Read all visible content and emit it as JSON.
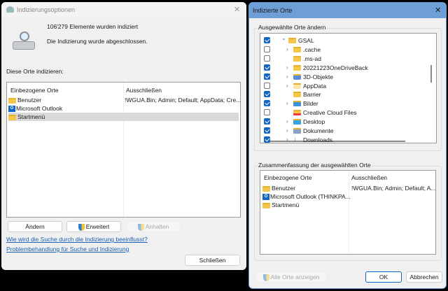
{
  "left": {
    "title": "Indizierungsoptionen",
    "count_text": "106'279 Elemente wurden indiziert",
    "status_text": "Die Indizierung wurde abgeschlossen.",
    "section_label": "Diese Orte indizieren:",
    "columns": [
      "Einbezogene Orte",
      "Ausschließen"
    ],
    "rows": [
      {
        "name": "Benutzer",
        "exclude": "!WGUA.Bin; Admin; Default; AppData; Cre..."
      },
      {
        "name": "Microsoft Outlook",
        "exclude": ""
      },
      {
        "name": "Startmenü",
        "exclude": ""
      }
    ],
    "buttons": {
      "change": "Ändern",
      "advanced": "Erweitert",
      "pause": "Anhalten",
      "close": "Schließen"
    },
    "links": [
      "Wie wird die Suche durch die Indizierung beeinflusst?",
      "Problembehandlung für Suche und Indizierung"
    ]
  },
  "right": {
    "title": "Indizierte Orte",
    "group1": "Ausgewählte Orte ändern",
    "tree": [
      {
        "name": "GSAL",
        "checked": true
      },
      {
        "name": ".cache",
        "checked": false
      },
      {
        "name": ".ms-ad",
        "checked": false
      },
      {
        "name": "20221223OneDriveBack",
        "checked": true
      },
      {
        "name": "3D-Objekte",
        "checked": true
      },
      {
        "name": "AppData",
        "checked": false
      },
      {
        "name": "Barrier",
        "checked": true
      },
      {
        "name": "Bilder",
        "checked": true
      },
      {
        "name": "Creative Cloud Files",
        "checked": false
      },
      {
        "name": "Desktop",
        "checked": true
      },
      {
        "name": "Dokumente",
        "checked": true
      },
      {
        "name": "Downloads",
        "checked": true
      }
    ],
    "group2": "Zusammenfassung der ausgewählten Orte",
    "columns": [
      "Einbezogene Orte",
      "Ausschließen"
    ],
    "rows": [
      {
        "name": "Benutzer",
        "exclude": "!WGUA.Bin; Admin; Default; A..."
      },
      {
        "name": "Microsoft Outlook (THINKPA...",
        "exclude": ""
      },
      {
        "name": "Startmenü",
        "exclude": ""
      }
    ],
    "buttons": {
      "show_all": "Alle Orte anzeigen",
      "ok": "OK",
      "cancel": "Abbrechen"
    }
  }
}
